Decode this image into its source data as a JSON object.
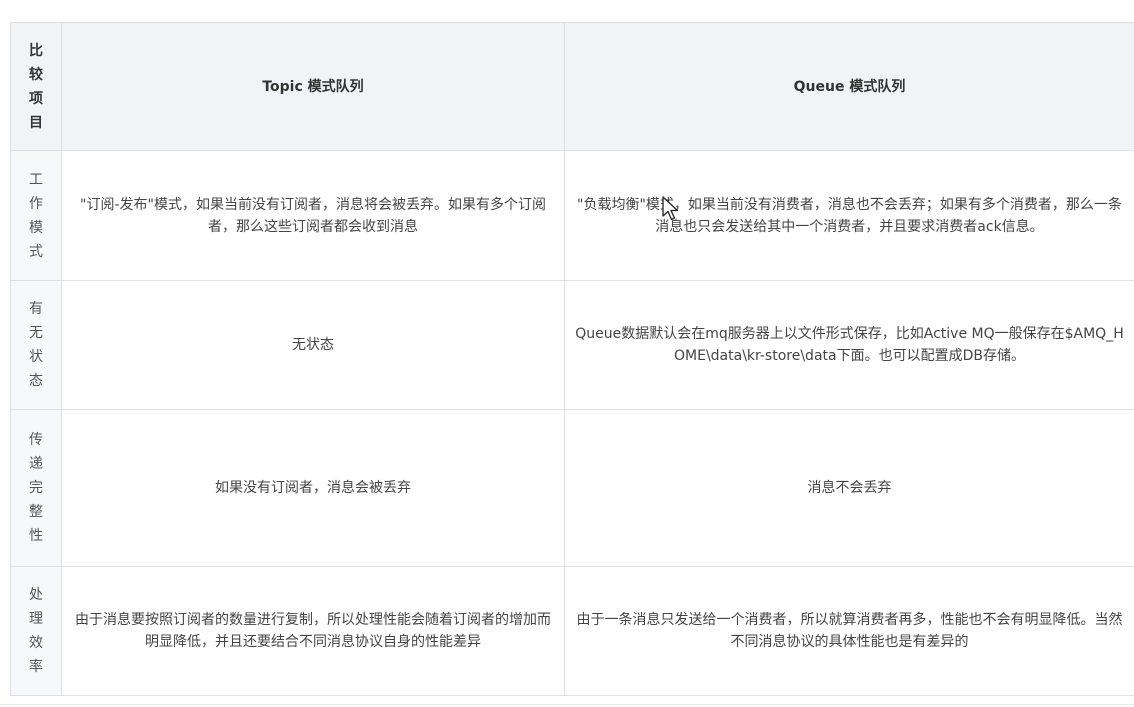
{
  "table": {
    "headers": {
      "item": "比较项目",
      "topic": "Topic 模式队列",
      "queue": "Queue 模式队列"
    },
    "rows": [
      {
        "label": "工作模式",
        "topic": "\"订阅-发布\"模式，如果当前没有订阅者，消息将会被丢弃。如果有多个订阅者，那么这些订阅者都会收到消息",
        "queue": "\"负载均衡\"模式，如果当前没有消费者，消息也不会丢弃；如果有多个消费者，那么一条消息也只会发送给其中一个消费者，并且要求消费者ack信息。"
      },
      {
        "label": "有无状态",
        "topic": "无状态",
        "queue": "Queue数据默认会在mq服务器上以文件形式保存，比如Active MQ一般保存在$AMQ_HOME\\data\\kr-store\\data下面。也可以配置成DB存储。"
      },
      {
        "label": "传递完整性",
        "topic": "如果没有订阅者，消息会被丢弃",
        "queue": "消息不会丢弃"
      },
      {
        "label": "处理效率",
        "topic": "由于消息要按照订阅者的数量进行复制，所以处理性能会随着订阅者的增加而明显降低，并且还要结合不同消息协议自身的性能差异",
        "queue": "由于一条消息只发送给一个消费者，所以就算消费者再多，性能也不会有明显降低。当然不同消息协议的具体性能也是有差异的"
      }
    ]
  },
  "cursor": {
    "icon": "mouse-pointer-icon"
  }
}
